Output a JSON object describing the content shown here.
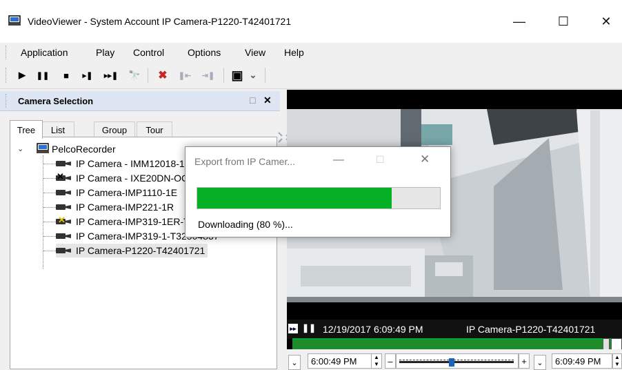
{
  "window": {
    "title": "VideoViewer - System Account IP Camera-P1220-T42401721",
    "min_glyph": "—",
    "max_glyph": "☐",
    "close_glyph": "✕"
  },
  "menu": {
    "items": [
      {
        "label": "Application",
        "name": "menu-application"
      },
      {
        "label": "Play",
        "name": "menu-play"
      },
      {
        "label": "Control",
        "name": "menu-control"
      },
      {
        "label": "Options",
        "name": "menu-options"
      },
      {
        "label": "View",
        "name": "menu-view"
      },
      {
        "label": "Help",
        "name": "menu-help"
      }
    ]
  },
  "toolbar": {
    "play": "▶",
    "pause": "❚❚",
    "stop": "■",
    "step": "▸❚",
    "skip": "▸▸❚",
    "find": "🔭",
    "delete": "✖",
    "mark_in": "❚⇤",
    "mark_out": "⇥❚",
    "layout": "▣",
    "dropdown": "⌄"
  },
  "panel": {
    "title": "Camera Selection",
    "restore_glyph": "□",
    "close_glyph": "✕",
    "tabs": [
      "Tree",
      "List",
      "Group",
      "Tour"
    ],
    "tree": {
      "root": "PelcoRecorder",
      "cameras": [
        "IP Camera - IMM12018-1",
        "IP Camera - IXE20DN-OCP",
        "IP Camera-IMP1110-1E",
        "IP Camera-IMP221-1R",
        "IP Camera-IMP319-1ER-T32503547",
        "IP Camera-IMP319-1-T32504837",
        "IP Camera-P1220-T42401721"
      ]
    }
  },
  "dialog": {
    "title": "Export from IP Camer...",
    "progress_fraction": 0.8,
    "status": "Downloading (80 %)..."
  },
  "player": {
    "timestamp": "12/19/2017 6:09:49 PM",
    "camera": "IP Camera-P1220-T42401721",
    "start_time": "6:00:49 PM",
    "end_time": "6:09:49 PM",
    "minus": "–",
    "plus": "+"
  },
  "colors": {
    "progress": "#06b025",
    "timeline": "#1f8b2a",
    "panel_header": "#dde6f2"
  }
}
